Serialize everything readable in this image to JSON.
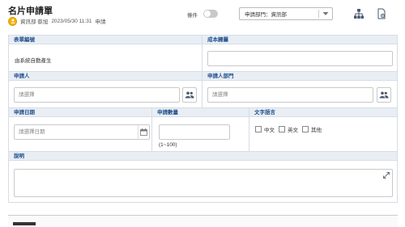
{
  "header": {
    "title": "名片申請單",
    "user": "資訊部 蔡旭",
    "datetime": "2023/05/30 11:31",
    "status": "申請",
    "condition_label": "條件",
    "dept_select_value": "申請部門：資訊部"
  },
  "form": {
    "form_no": {
      "label": "表單編號",
      "value": "由系統自動產生"
    },
    "cost_dept": {
      "label": "成本歸屬"
    },
    "applicant": {
      "label": "申請人",
      "placeholder": "請選擇"
    },
    "applicant_dept": {
      "label": "申請人部門",
      "placeholder": "請選擇"
    },
    "apply_date": {
      "label": "申請日期",
      "placeholder": "請選擇日期"
    },
    "quantity": {
      "label": "申請數量",
      "hint": "(1~100)"
    },
    "language": {
      "label": "文字語言",
      "options": [
        "中文",
        "英文",
        "其他"
      ]
    },
    "description": {
      "label": "說明"
    }
  },
  "colors": {
    "section_header_bg": "#e9eef5",
    "section_header_text": "#1f4e8c",
    "avatar": "#f4b400"
  }
}
